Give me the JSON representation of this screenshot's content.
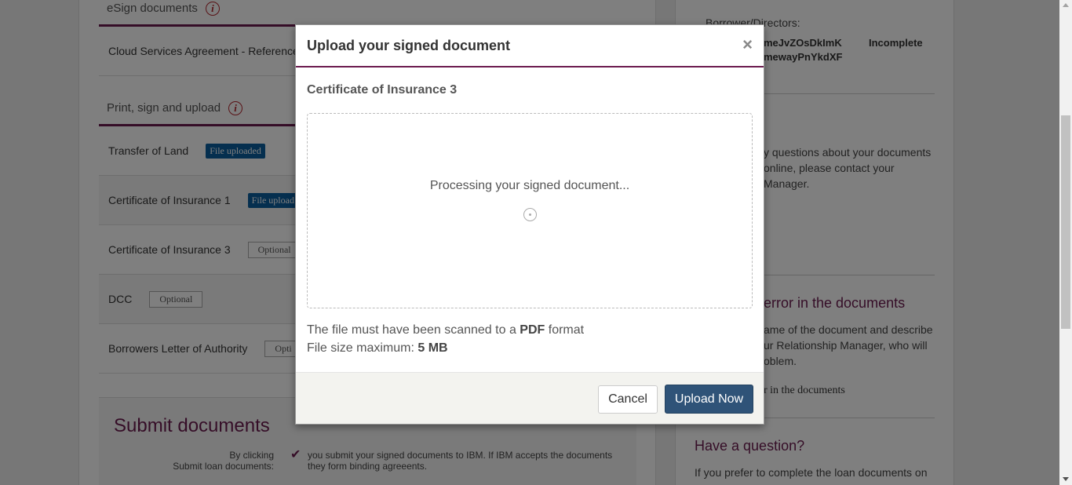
{
  "main": {
    "esign_heading": "eSign documents",
    "esign_rows": [
      {
        "name": "Cloud Services Agreement - Reference"
      }
    ],
    "print_heading": "Print, sign and upload",
    "print_rows": [
      {
        "name": "Transfer of Land",
        "status": "File uploaded"
      },
      {
        "name": "Certificate of Insurance 1",
        "status": "File upload"
      },
      {
        "name": "Certificate of Insurance 3",
        "status": "Optional"
      },
      {
        "name": "DCC",
        "status": "Optional"
      },
      {
        "name": "Borrowers Letter of Authority",
        "status": "Opti"
      }
    ],
    "submit": {
      "title": "Submit documents",
      "label_line1": "By clicking",
      "label_line2": "Submit loan documents:",
      "text": "you submit your signed documents to IBM. If IBM accepts the documents they form binding agreeents."
    }
  },
  "side": {
    "borrower_label": "Borrower/Directors:",
    "borrower_name_line1": "meJvZOsDkImK",
    "borrower_name_line2": "mewayPnYkdXF",
    "borrower_status": "Incomplete",
    "questions_line1": "y questions about your documents",
    "questions_line2": "online, please contact your",
    "questions_line3": "Manager.",
    "error_heading": "error in the documents",
    "error_line1": "ame of the document and describe",
    "error_line2": "ur Relationship Manager, who will",
    "error_line3": "oblem.",
    "error_link": "r in the documents",
    "question_heading": "Have a question?",
    "question_text": "If you prefer to complete the loan documents on"
  },
  "modal": {
    "title": "Upload your signed document",
    "close_label": "×",
    "document_name": "Certificate of Insurance 3",
    "processing_text": "Processing your signed document...",
    "format_text_prefix": "The file must have been scanned to a",
    "format_value": "PDF",
    "format_text_suffix": "format",
    "size_label": "File size maximum:",
    "size_value": "5 MB",
    "cancel_label": "Cancel",
    "upload_label": "Upload Now"
  },
  "colors": {
    "accent": "#6b1b4e",
    "primary_button": "#2f5378",
    "badge_uploaded": "#0a5e9e",
    "info_icon": "#b3262e"
  }
}
